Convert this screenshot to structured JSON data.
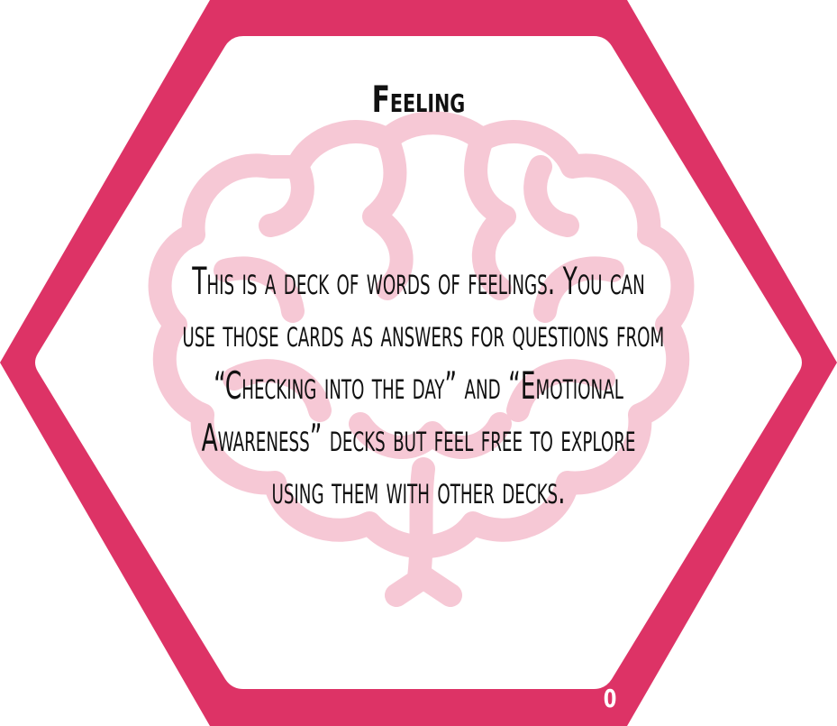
{
  "card": {
    "title": "Feeling",
    "body_lines": [
      "This is a deck of words of feelings. You can",
      "use those cards as answers for questions from",
      "“Checking into the day” and “Emotional",
      "Awareness” decks but feel free to explore",
      "using them with other decks."
    ],
    "number": "0"
  },
  "colors": {
    "frame": "#dd3366",
    "frame_inner": "#ffffff",
    "watermark": "#f5c6d3",
    "text": "#111111",
    "number": "#ffffff"
  },
  "icons": {
    "watermark": "brain-icon"
  }
}
